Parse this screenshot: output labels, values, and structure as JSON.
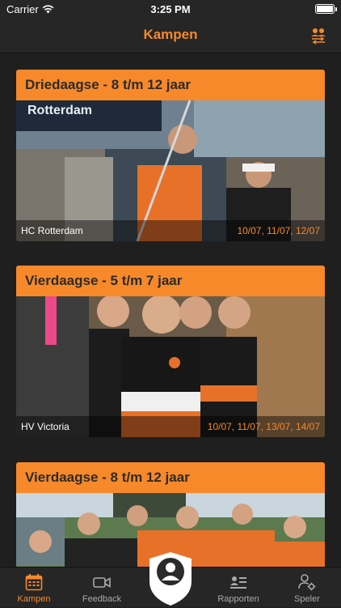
{
  "status_bar": {
    "carrier": "Carrier",
    "time": "3:25 PM"
  },
  "nav": {
    "title": "Kampen",
    "right_icon": "swap-users-icon"
  },
  "camps": [
    {
      "title": "Driedaagse - 8 t/m 12 jaar",
      "club": "HC Rotterdam",
      "dates": "10/07, 11/07, 12/07",
      "photo_text": "Rotterdam"
    },
    {
      "title": "Vierdaagse - 5 t/m 7 jaar",
      "club": "HV Victoria",
      "dates": "10/07, 11/07, 13/07, 14/07"
    },
    {
      "title": "Vierdaagse - 8 t/m 12 jaar",
      "club": "",
      "dates": ""
    }
  ],
  "tabs": [
    {
      "label": "Kampen",
      "icon": "calendar-icon",
      "active": true
    },
    {
      "label": "Feedback",
      "icon": "video-camera-icon",
      "active": false
    },
    {
      "label": "",
      "icon": "profile-shield-icon",
      "active": false
    },
    {
      "label": "Rapporten",
      "icon": "report-list-icon",
      "active": false
    },
    {
      "label": "Speler",
      "icon": "player-settings-icon",
      "active": false
    }
  ],
  "colors": {
    "accent": "#f7892a",
    "background": "#1f1f1f",
    "bar": "#262626"
  }
}
